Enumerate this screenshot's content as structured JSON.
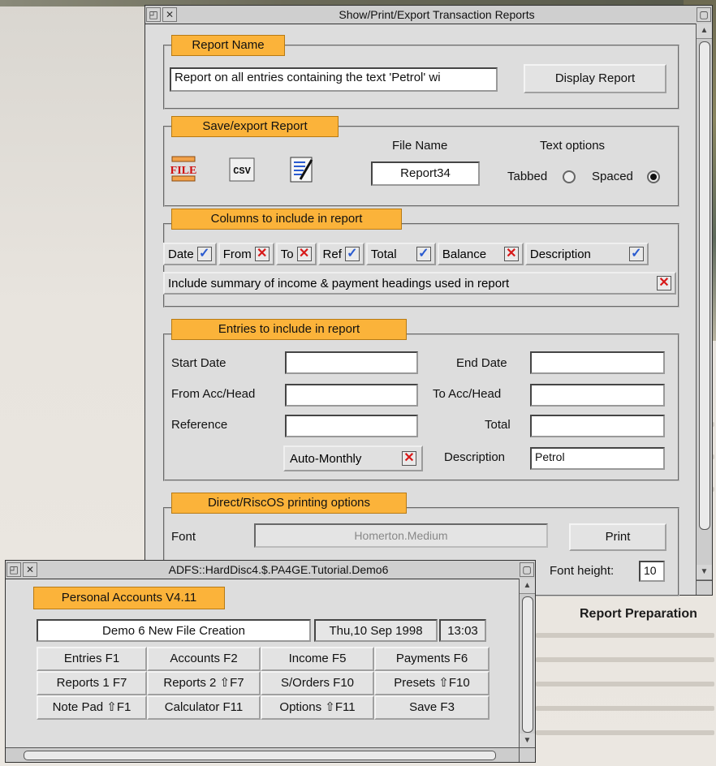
{
  "report_window": {
    "title": "Show/Print/Export Transaction Reports",
    "report_name": {
      "heading": "Report Name",
      "value": "Report on all entries containing the text 'Petrol' wi",
      "display_button": "Display Report"
    },
    "save_export": {
      "heading": "Save/export Report",
      "file_icon_text": "FILE",
      "csv_icon_text": "CSV",
      "file_name_label": "File Name",
      "file_name_value": "Report34",
      "text_options_label": "Text options",
      "tabbed_label": "Tabbed",
      "spaced_label": "Spaced",
      "tabbed_selected": false,
      "spaced_selected": true
    },
    "columns": {
      "heading": "Columns to include in report",
      "items": [
        {
          "label": "Date",
          "checked": true
        },
        {
          "label": "From",
          "checked": false
        },
        {
          "label": "To",
          "checked": false
        },
        {
          "label": "Ref",
          "checked": true
        },
        {
          "label": "Total",
          "checked": true
        },
        {
          "label": "Balance",
          "checked": false
        },
        {
          "label": "Description",
          "checked": true
        }
      ],
      "summary_label": "Include summary of income & payment headings used in report",
      "summary_checked": false
    },
    "entries": {
      "heading": "Entries to include in report",
      "start_date_label": "Start Date",
      "start_date_value": "",
      "end_date_label": "End Date",
      "end_date_value": "",
      "from_acc_label": "From Acc/Head",
      "from_acc_value": "",
      "to_acc_label": "To Acc/Head",
      "to_acc_value": "",
      "reference_label": "Reference",
      "reference_value": "",
      "total_label": "Total",
      "total_value": "",
      "auto_monthly_label": "Auto-Monthly",
      "auto_monthly_checked": false,
      "description_label": "Description",
      "description_value": "Petrol"
    },
    "printing": {
      "heading": "Direct/RiscOS printing options",
      "font_label": "Font",
      "font_value": "Homerton.Medium",
      "print_button": "Print",
      "font_height_label": "Font height:",
      "font_height_value": "10"
    }
  },
  "main_window": {
    "title": "ADFS::HardDisc4.$.PA4GE.Tutorial.Demo6",
    "app_name": "Personal Accounts V4.11",
    "file_title": "Demo 6 New File Creation",
    "date": "Thu,10 Sep 1998",
    "time": "13:03",
    "buttons": [
      [
        "Entries F1",
        "Accounts F2",
        "Income F5",
        "Payments F6"
      ],
      [
        "Reports 1 F7",
        "Reports 2 ⇧F7",
        "S/Orders F10",
        "Presets ⇧F10"
      ],
      [
        "Note Pad ⇧F1",
        "Calculator F11",
        "Options ⇧F11",
        "Save F3"
      ]
    ]
  },
  "caption": "Report Preparation",
  "colors": {
    "accent": "#fbb33a",
    "tick": "#2a5bd0",
    "cross": "#d81818",
    "window_bg": "#dddddd"
  }
}
